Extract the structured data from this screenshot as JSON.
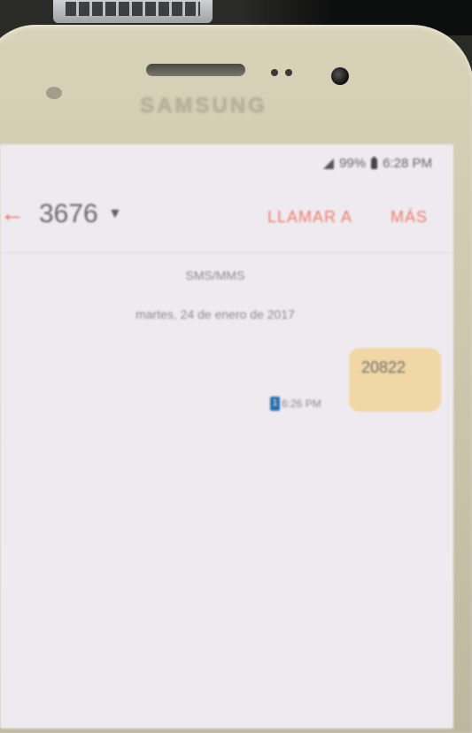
{
  "device": {
    "brand": "SAMSUNG"
  },
  "status_bar": {
    "battery": "99%",
    "time": "6:28 PM",
    "icons": [
      "signal-icon",
      "battery-icon"
    ]
  },
  "app_bar": {
    "contact": "3676",
    "call_label": "LLAMAR A",
    "more_label": "MÁS",
    "icons": [
      "back-arrow-icon",
      "caret-down-icon"
    ]
  },
  "conversation": {
    "thread_type": "SMS/MMS",
    "date": "martes, 24 de enero de 2017",
    "messages": [
      {
        "text": "20822",
        "time": "6:26 PM",
        "sim": "1"
      }
    ]
  },
  "colors": {
    "accent": "#ee7d6a",
    "bubble": "#f1d7a6",
    "screen": "#eeeaf0"
  }
}
